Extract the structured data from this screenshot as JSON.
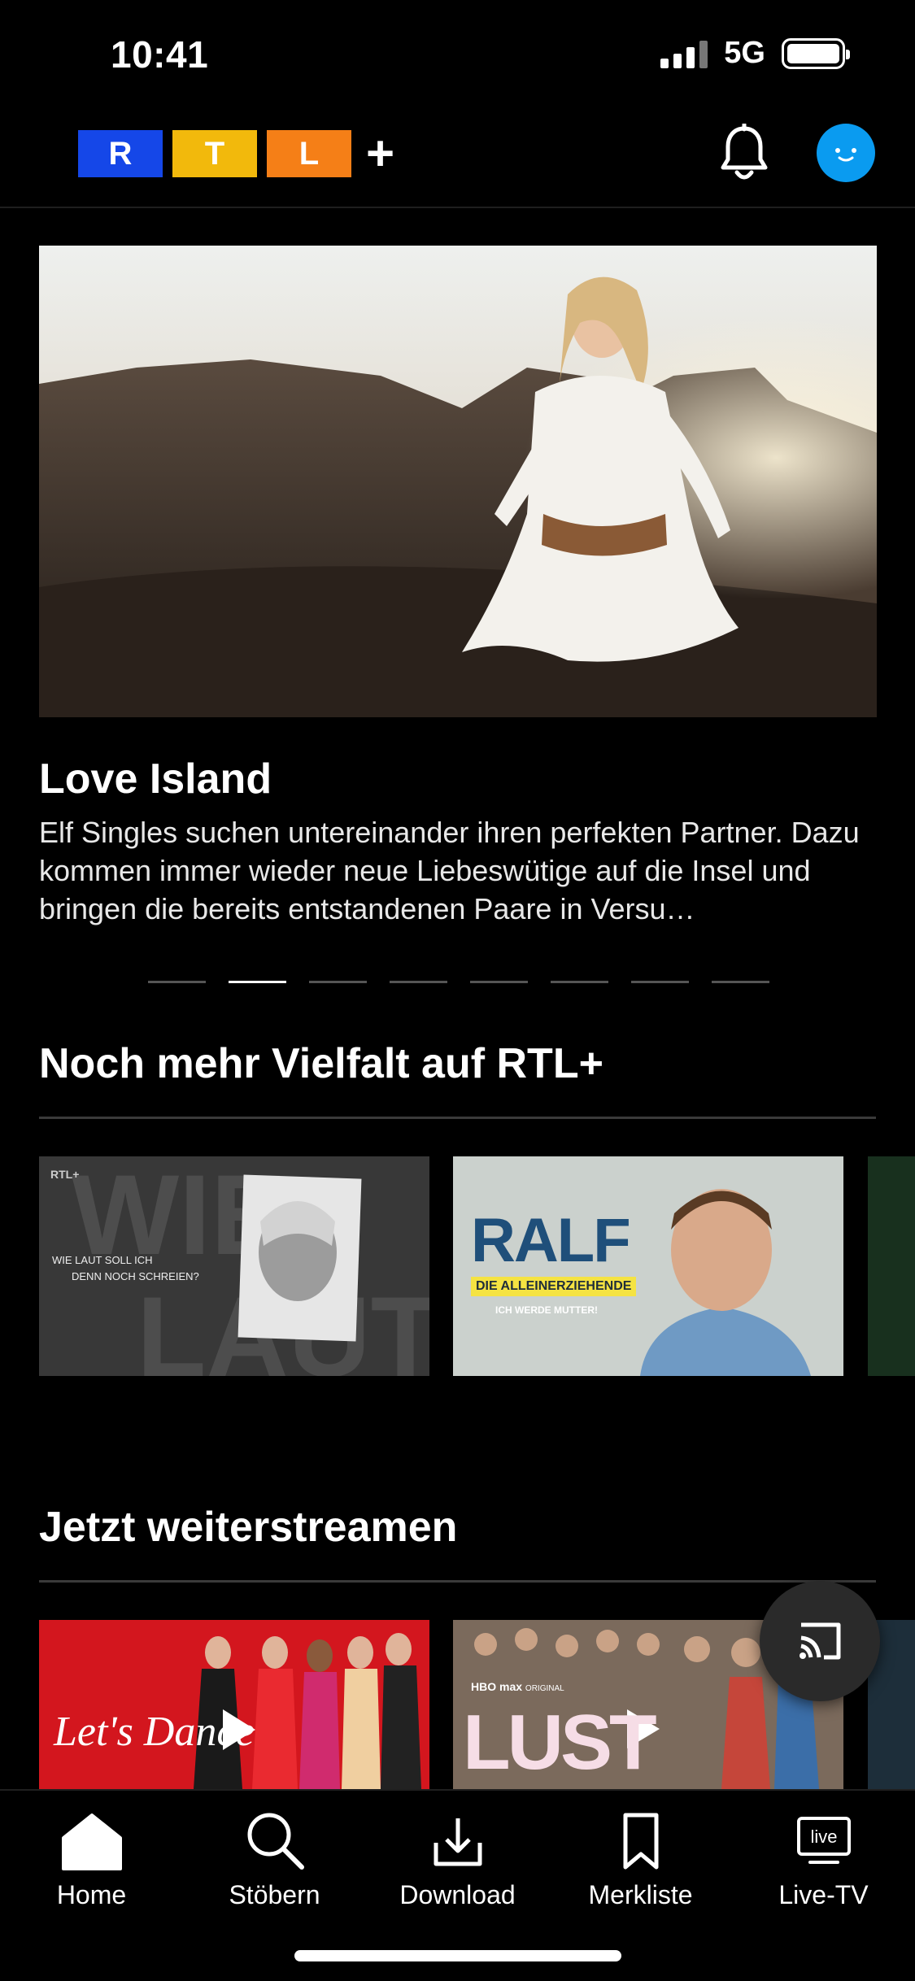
{
  "status": {
    "time": "10:41",
    "network": "5G"
  },
  "header": {
    "logo": {
      "letters": [
        "R",
        "T",
        "L"
      ],
      "plus": "+",
      "colors": [
        "#1547e8",
        "#f2b90c",
        "#f57f17"
      ]
    },
    "bell_icon": "bell-icon",
    "avatar_color": "#0a9bf0"
  },
  "hero": {
    "title": "Love Island",
    "description": "Elf Singles suchen untereinander ihren perfekten Partner. Dazu kommen immer wieder neue Liebeswütige auf die Insel und bringen die bereits entstandenen Paare in Versu…",
    "pagination_count": 8,
    "active_index": 1
  },
  "section1": {
    "title": "Noch mehr Vielfalt auf RTL+",
    "cards": [
      {
        "tag": "RTL+",
        "bg_text": "WIE",
        "line1": "WIE LAUT SOLL ICH",
        "line2": "DENN NOCH SCHREIEN?",
        "bottom_text": "LAUT"
      },
      {
        "title": "RALF",
        "subtitle": "DIE ALLEINERZIEHENDE",
        "tagline": "ICH WERDE MUTTER!"
      }
    ]
  },
  "section2": {
    "title": "Jetzt weiterstreamen",
    "cards": [
      {
        "title": "Let's Dance"
      },
      {
        "brand": "HBO max",
        "brand_suffix": "ORIGINAL",
        "title": "LUST"
      }
    ]
  },
  "tabs": [
    {
      "label": "Home",
      "icon": "home-icon"
    },
    {
      "label": "Stöbern",
      "icon": "search-icon"
    },
    {
      "label": "Download",
      "icon": "download-icon"
    },
    {
      "label": "Merkliste",
      "icon": "bookmark-icon"
    },
    {
      "label": "Live-TV",
      "icon": "live-tv-icon",
      "icon_text": "live"
    }
  ]
}
